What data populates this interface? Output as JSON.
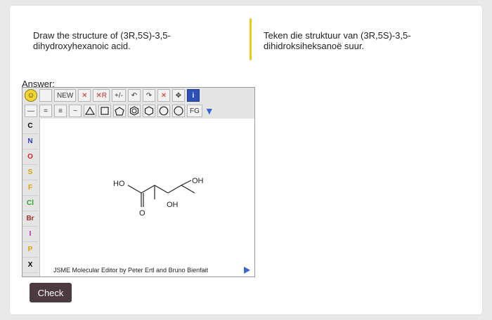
{
  "question": {
    "english": "Draw the structure of (3R,5S)-3,5-dihydroxyhexanoic acid.",
    "afrikaans": "Teken die struktuur van (3R,5S)-3,5-dihidroksiheksanoë suur."
  },
  "answer_label": "Answer:",
  "editor": {
    "toolbar_row1": {
      "new_label": "NEW",
      "delete_label": "✕",
      "r_group_label": "✕R",
      "charge_label": "+/-",
      "undo_label": "↶",
      "redo_label": "↷",
      "clear_label": "✕",
      "move_label": "✥",
      "info_label": "i"
    },
    "toolbar_row2": {
      "single_bond": "—",
      "double_bond": "=",
      "triple_bond": "≡",
      "chain": "~",
      "fg_label": "FG"
    },
    "atoms": [
      "C",
      "N",
      "O",
      "S",
      "F",
      "Cl",
      "Br",
      "I",
      "P",
      "X"
    ],
    "atom_colors": [
      "#000000",
      "#2b3ccf",
      "#d82020",
      "#c9a800",
      "#e2a000",
      "#2aa52a",
      "#a0302a",
      "#b72aa8",
      "#e0a000",
      "#000000"
    ],
    "molecule": {
      "label_ho": "HO",
      "label_o": "O",
      "label_oh_bottom": "OH",
      "label_oh_top": "OH"
    },
    "footer": "JSME Molecular Editor by Peter Ertl and Bruno Bienfait"
  },
  "check_label": "Check",
  "colors": {
    "accent_divider": "#f5c518",
    "check_button": "#4b3b40",
    "jsme_blue": "#3566d6"
  }
}
